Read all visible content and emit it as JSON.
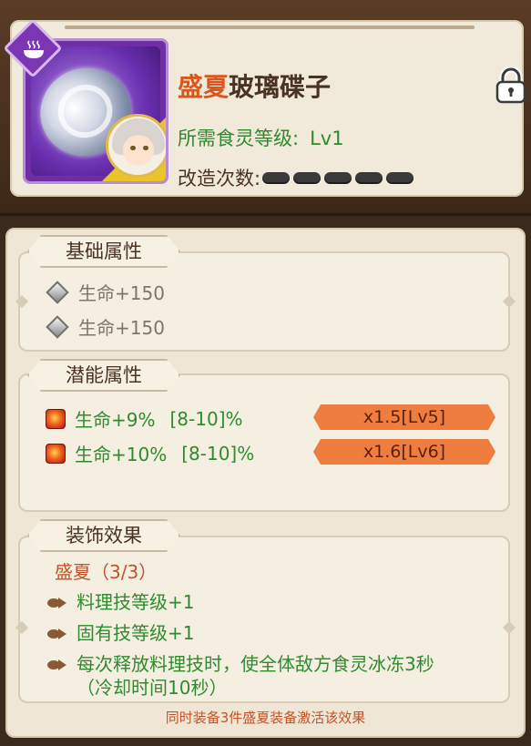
{
  "item": {
    "name_highlight": "盛夏",
    "name_rest": "玻璃碟子",
    "required_level_label": "所需食灵等级:",
    "required_level_value": "Lv1",
    "refine_label": "改造次数:",
    "refine_pips": 5,
    "badge_icon": "food-dish-icon",
    "lock_icon": "lock-icon"
  },
  "base_attributes": {
    "title": "基础属性",
    "rows": [
      "生命+150",
      "生命+150"
    ]
  },
  "potential_attributes": {
    "title": "潜能属性",
    "rows": [
      {
        "text": "生命+9%",
        "range": "[8-10]%",
        "multiplier": "x1.5[Lv5]"
      },
      {
        "text": "生命+10%",
        "range": "[8-10]%",
        "multiplier": "x1.6[Lv6]"
      }
    ]
  },
  "decoration_effect": {
    "title": "装饰效果",
    "set_name": "盛夏（3/3）",
    "effects": [
      "料理技等级+1",
      "固有技等级+1",
      "每次释放料理技时，使全体敌方食灵冰冻3秒（冷却时间10秒）"
    ],
    "footer": "同时装备3件盛夏装备激活该效果"
  },
  "colors": {
    "highlight": "#d9571f",
    "green_text": "#2e8b2e",
    "multiplier_bg": "#ee7d3f",
    "frame_purple": "#6f2ea5"
  }
}
